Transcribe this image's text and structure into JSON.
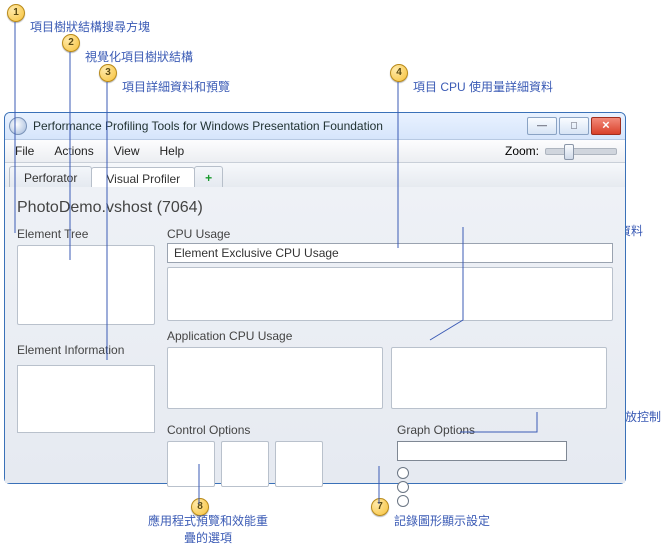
{
  "callouts": {
    "c1": "項目樹狀結構搜尋方塊",
    "c2": "視覺化項目樹狀結構",
    "c3": "項目詳細資料和預覽",
    "c4": "項目 CPU 使用量詳細資料",
    "c5": "應用程式 CPU 使用量詳細資料",
    "c6": "擷取的資料縮放控制",
    "c7": "記錄圖形顯示設定",
    "c8": "應用程式預覽和效能重疊的選項"
  },
  "window": {
    "title": "Performance Profiling Tools for Windows Presentation Foundation"
  },
  "menu": {
    "file": "File",
    "actions": "Actions",
    "view": "View",
    "help": "Help",
    "zoom": "Zoom:"
  },
  "tabs": {
    "perforator": "Perforator",
    "visual_profiler": "Visual Profiler",
    "plus": "+"
  },
  "process_title": "PhotoDemo.vshost (7064)",
  "left": {
    "element_tree": "Element Tree",
    "element_info": "Element Information"
  },
  "right": {
    "cpu_usage": "CPU Usage",
    "elem_excl": "Element Exclusive CPU Usage",
    "app_cpu": "Application CPU Usage",
    "control_options": "Control Options",
    "graph_options": "Graph Options"
  }
}
